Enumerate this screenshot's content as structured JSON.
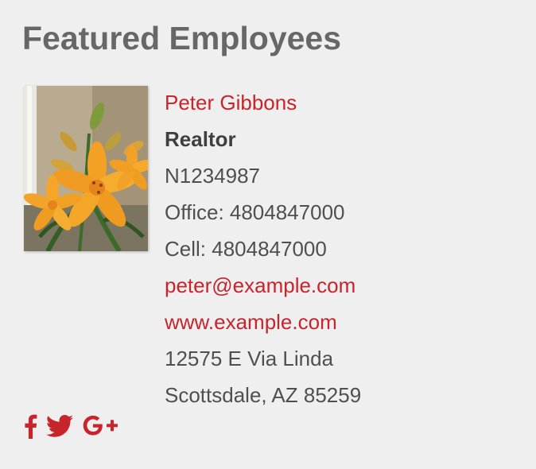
{
  "section": {
    "heading": "Featured Employees"
  },
  "employee": {
    "photo_alt": "Orange lily flower photo",
    "name": "Peter Gibbons",
    "title": "Realtor",
    "license": "N1234987",
    "office": "Office: 4804847000",
    "cell": "Cell: 4804847000",
    "email": "peter@example.com",
    "website": "www.example.com",
    "address_line1": "12575 E Via Linda",
    "address_line2": "Scottsdale, AZ 85259"
  },
  "social": {
    "icons": [
      "facebook-icon",
      "twitter-icon",
      "google-plus-icon"
    ]
  },
  "colors": {
    "background": "#efefef",
    "heading": "#676767",
    "accent": "#c8242c",
    "text": "#4f4f4f"
  }
}
